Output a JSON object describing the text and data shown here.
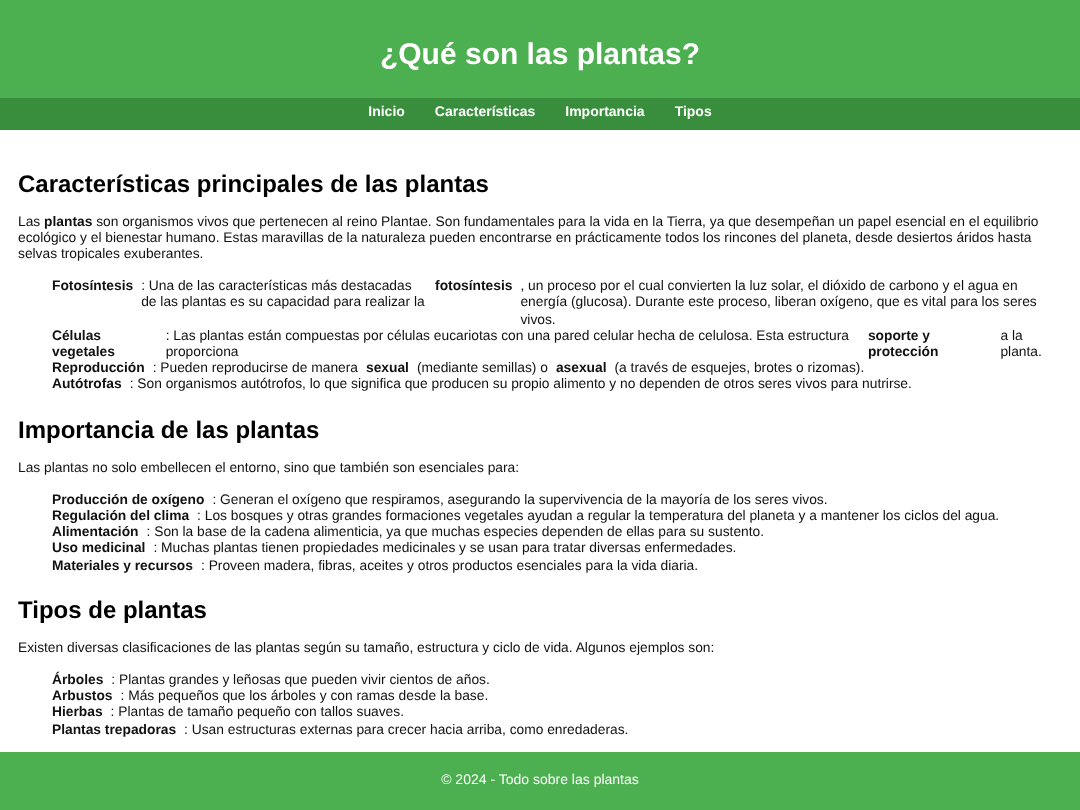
{
  "header": {
    "title": "¿Qué son las plantas?"
  },
  "nav": [
    {
      "label": "Inicio"
    },
    {
      "label": "Características"
    },
    {
      "label": "Importancia"
    },
    {
      "label": "Tipos"
    }
  ],
  "sections": [
    {
      "heading": "Características principales de las plantas",
      "intro": "Las **plantas** son organismos vivos que pertenecen al reino Plantae. Son fundamentales para la vida en la Tierra, ya que desempeñan un papel esencial en el equilibrio ecológico y el bienestar humano. Estas maravillas de la naturaleza pueden encontrarse en prácticamente todos los rincones del planeta, desde desiertos áridos hasta selvas tropicales exuberantes.",
      "items": [
        "**Fotosíntesis**: Una de las características más destacadas de las plantas es su capacidad para realizar la **fotosíntesis**, un proceso por el cual convierten la luz solar, el dióxido de carbono y el agua en energía (glucosa). Durante este proceso, liberan oxígeno, que es vital para los seres vivos.",
        "**Células vegetales**: Las plantas están compuestas por células eucariotas con una pared celular hecha de celulosa. Esta estructura proporciona **soporte y protección** a la planta.",
        "**Reproducción**: Pueden reproducirse de manera **sexual** (mediante semillas) o **asexual** (a través de esquejes, brotes o rizomas).",
        "**Autótrofas**: Son organismos autótrofos, lo que significa que producen su propio alimento y no dependen de otros seres vivos para nutrirse."
      ]
    },
    {
      "heading": "Importancia de las plantas",
      "intro": "Las plantas no solo embellecen el entorno, sino que también son esenciales para:",
      "items": [
        "**Producción de oxígeno**: Generan el oxígeno que respiramos, asegurando la supervivencia de la mayoría de los seres vivos.",
        "**Regulación del clima**: Los bosques y otras grandes formaciones vegetales ayudan a regular la temperatura del planeta y a mantener los ciclos del agua.",
        "**Alimentación**: Son la base de la cadena alimenticia, ya que muchas especies dependen de ellas para su sustento.",
        "**Uso medicinal**: Muchas plantas tienen propiedades medicinales y se usan para tratar diversas enfermedades.",
        "**Materiales y recursos**: Proveen madera, fibras, aceites y otros productos esenciales para la vida diaria."
      ]
    },
    {
      "heading": "Tipos de plantas",
      "intro": "Existen diversas clasificaciones de las plantas según su tamaño, estructura y ciclo de vida. Algunos ejemplos son:",
      "items": [
        "**Árboles**: Plantas grandes y leñosas que pueden vivir cientos de años.",
        "**Arbustos**: Más pequeños que los árboles y con ramas desde la base.",
        "**Hierbas**: Plantas de tamaño pequeño con tallos suaves.",
        "**Plantas trepadoras**: Usan estructuras externas para crecer hacia arriba, como enredaderas."
      ]
    }
  ],
  "footer": {
    "text": "© 2024 - Todo sobre las plantas"
  }
}
